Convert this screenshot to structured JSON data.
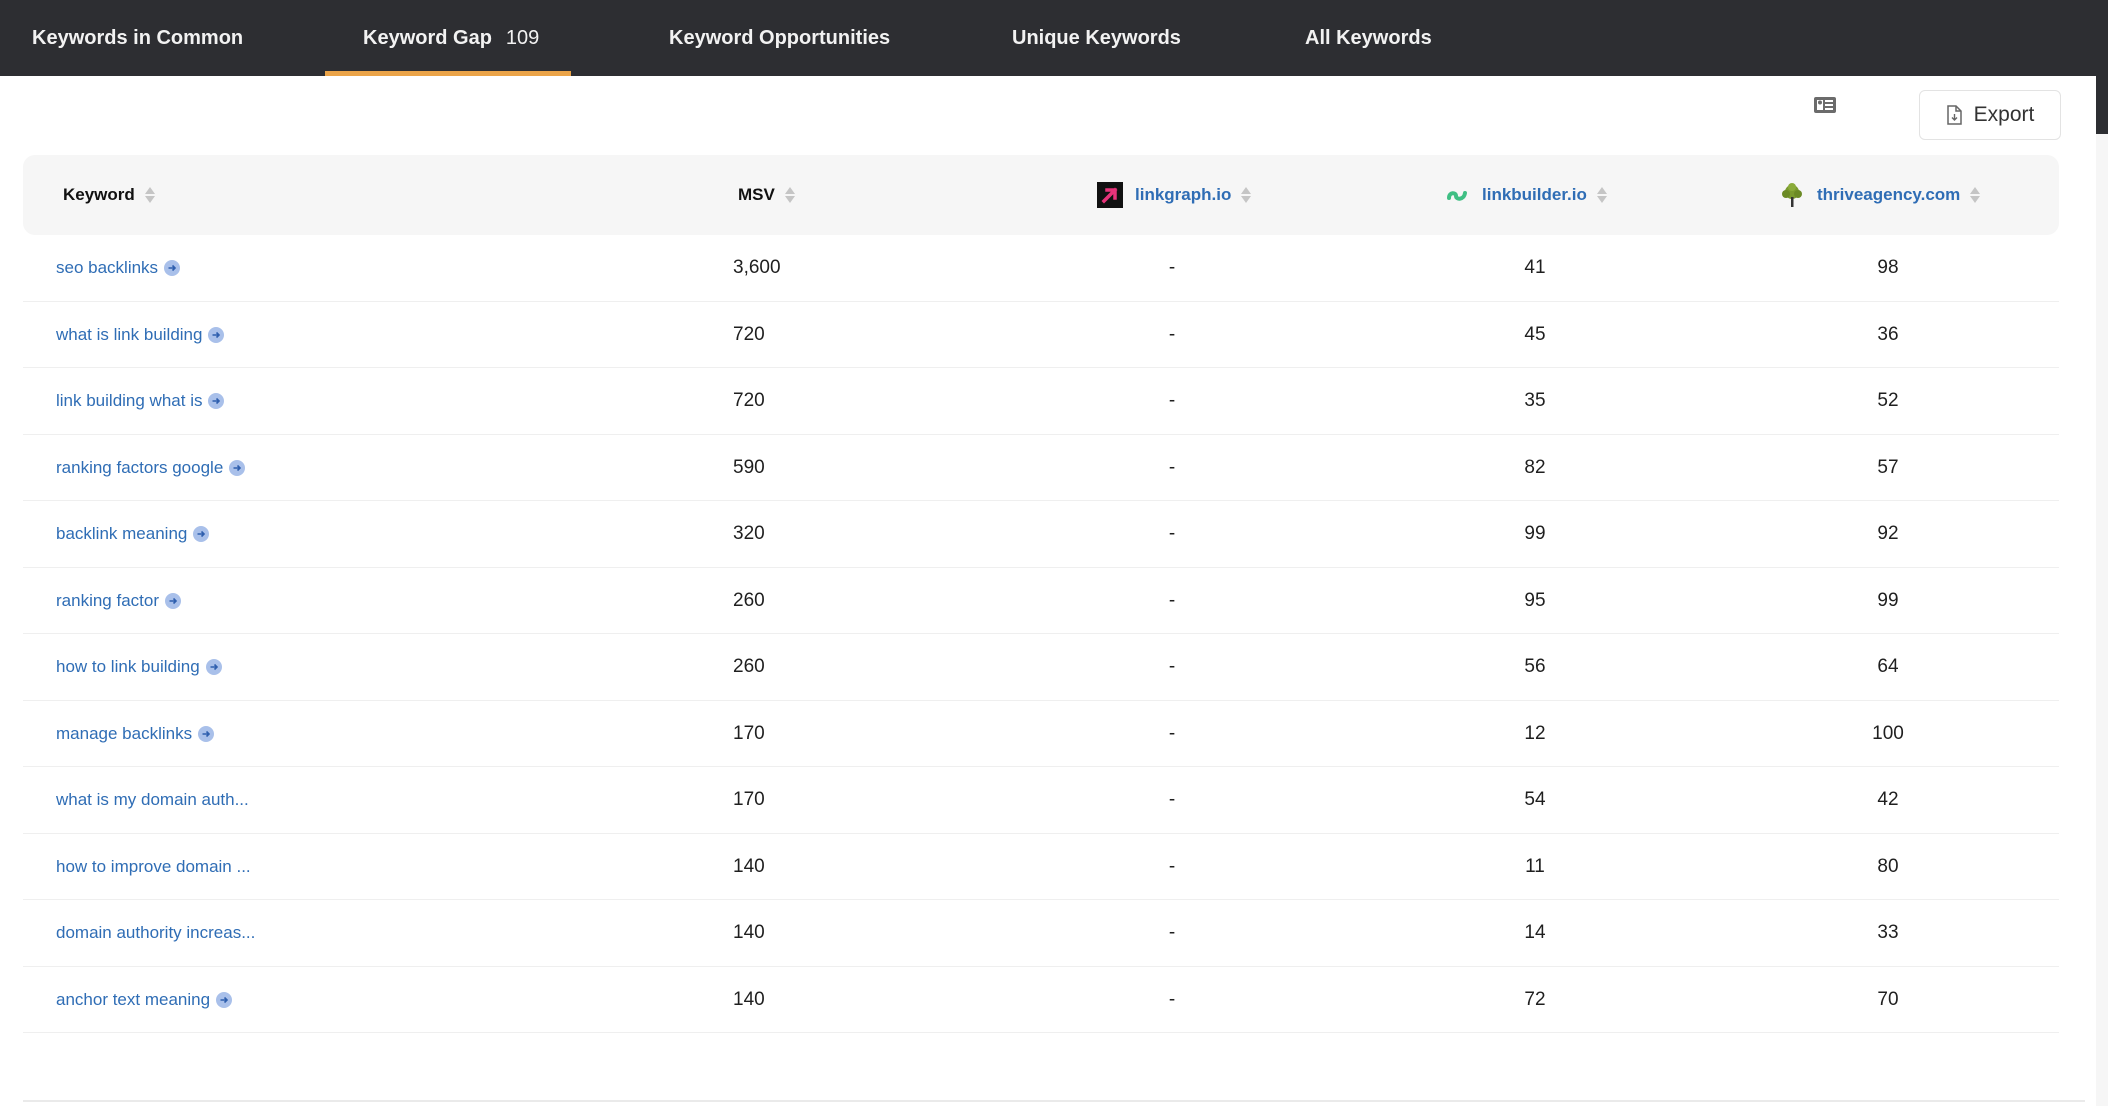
{
  "tabs": [
    {
      "label": "Keywords in Common",
      "count": null,
      "active": false
    },
    {
      "label": "Keyword Gap",
      "count": "109",
      "active": true
    },
    {
      "label": "Keyword Opportunities",
      "count": null,
      "active": false
    },
    {
      "label": "Unique Keywords",
      "count": null,
      "active": false
    },
    {
      "label": "All Keywords",
      "count": null,
      "active": false
    }
  ],
  "toolbar": {
    "column_toggle_icon": "id-card-icon",
    "export_label": "Export",
    "export_icon": "file-download-icon"
  },
  "colors": {
    "tabbar_bg": "#2d2e32",
    "active_tab_indicator": "#eba448",
    "link_blue": "#2f6db5",
    "header_bg": "#f6f6f6",
    "go_icon_bg": "#a9c0ea"
  },
  "table": {
    "headers": {
      "keyword": "Keyword",
      "msv": "MSV",
      "domain1": {
        "name": "linkgraph.io",
        "icon": "linkgraph-logo-icon"
      },
      "domain2": {
        "name": "linkbuilder.io",
        "icon": "linkbuilder-logo-icon"
      },
      "domain3": {
        "name": "thriveagency.com",
        "icon": "thriveagency-logo-icon"
      }
    },
    "rows": [
      {
        "keyword": "seo backlinks",
        "has_go": true,
        "msv": "3,600",
        "d1": "-",
        "d2": "41",
        "d3": "98"
      },
      {
        "keyword": "what is link building",
        "has_go": true,
        "msv": "720",
        "d1": "-",
        "d2": "45",
        "d3": "36"
      },
      {
        "keyword": "link building what is",
        "has_go": true,
        "msv": "720",
        "d1": "-",
        "d2": "35",
        "d3": "52"
      },
      {
        "keyword": "ranking factors google",
        "has_go": true,
        "msv": "590",
        "d1": "-",
        "d2": "82",
        "d3": "57"
      },
      {
        "keyword": "backlink meaning",
        "has_go": true,
        "msv": "320",
        "d1": "-",
        "d2": "99",
        "d3": "92"
      },
      {
        "keyword": "ranking factor",
        "has_go": true,
        "msv": "260",
        "d1": "-",
        "d2": "95",
        "d3": "99"
      },
      {
        "keyword": "how to link building",
        "has_go": true,
        "msv": "260",
        "d1": "-",
        "d2": "56",
        "d3": "64"
      },
      {
        "keyword": "manage backlinks",
        "has_go": true,
        "msv": "170",
        "d1": "-",
        "d2": "12",
        "d3": "100"
      },
      {
        "keyword": "what is my domain auth...",
        "has_go": false,
        "msv": "170",
        "d1": "-",
        "d2": "54",
        "d3": "42"
      },
      {
        "keyword": "how to improve domain ...",
        "has_go": false,
        "msv": "140",
        "d1": "-",
        "d2": "11",
        "d3": "80"
      },
      {
        "keyword": "domain authority increas...",
        "has_go": false,
        "msv": "140",
        "d1": "-",
        "d2": "14",
        "d3": "33"
      },
      {
        "keyword": "anchor text meaning",
        "has_go": true,
        "msv": "140",
        "d1": "-",
        "d2": "72",
        "d3": "70"
      }
    ]
  }
}
